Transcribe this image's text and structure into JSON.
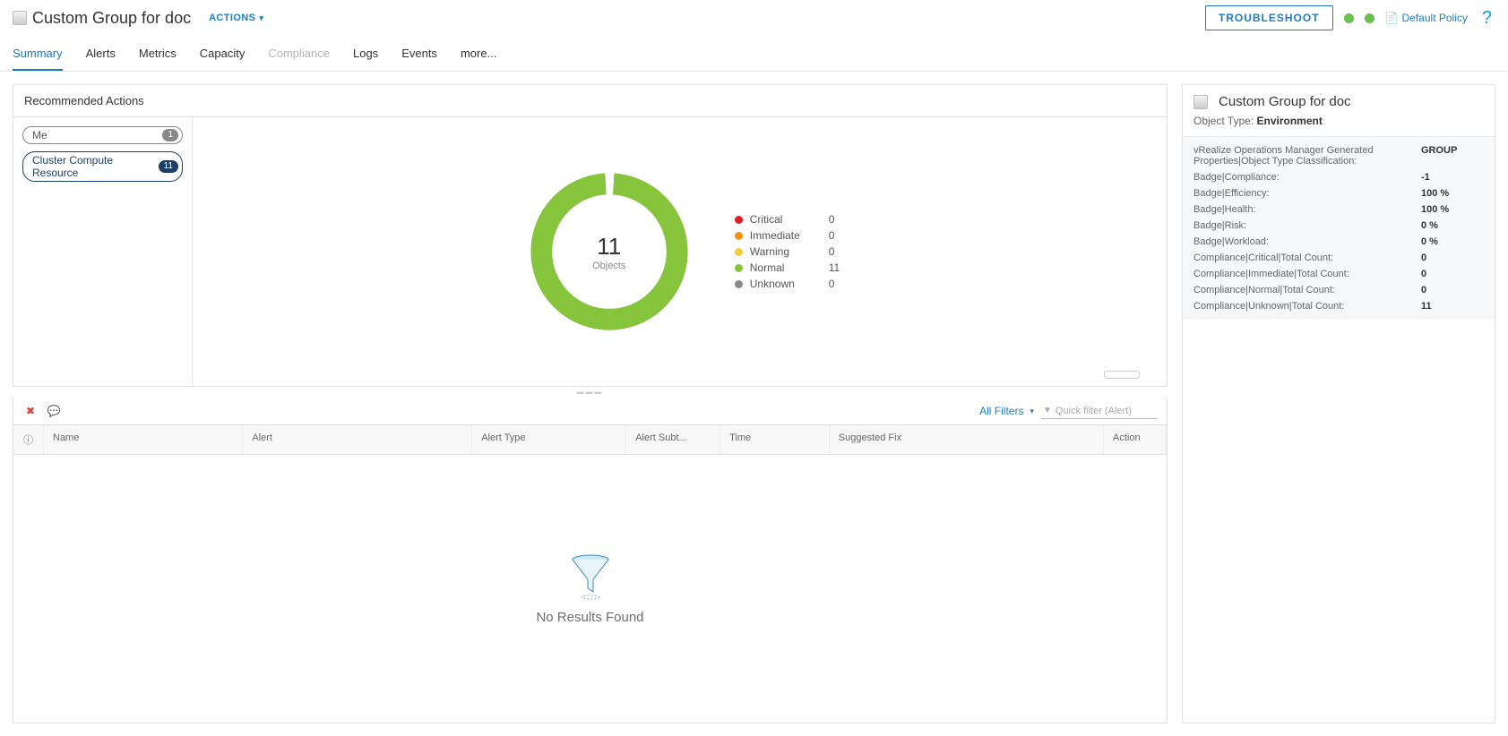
{
  "header": {
    "title": "Custom Group for doc",
    "actions_label": "ACTIONS",
    "troubleshoot_label": "TROUBLESHOOT",
    "policy_label": "Default Policy"
  },
  "tabs": [
    {
      "label": "Summary",
      "active": true,
      "disabled": false
    },
    {
      "label": "Alerts",
      "active": false,
      "disabled": false
    },
    {
      "label": "Metrics",
      "active": false,
      "disabled": false
    },
    {
      "label": "Capacity",
      "active": false,
      "disabled": false
    },
    {
      "label": "Compliance",
      "active": false,
      "disabled": true
    },
    {
      "label": "Logs",
      "active": false,
      "disabled": false
    },
    {
      "label": "Events",
      "active": false,
      "disabled": false
    },
    {
      "label": "more...",
      "active": false,
      "disabled": false
    }
  ],
  "recommended": {
    "title": "Recommended Actions",
    "filters": [
      {
        "label": "Me",
        "count": "1",
        "active": false
      },
      {
        "label": "Cluster Compute Resource",
        "count": "11",
        "active": true
      }
    ]
  },
  "chart_data": {
    "type": "pie",
    "total_value": "11",
    "total_label": "Objects",
    "series": [
      {
        "name": "Critical",
        "value": 0,
        "color": "#e02020"
      },
      {
        "name": "Immediate",
        "value": 0,
        "color": "#f2940a"
      },
      {
        "name": "Warning",
        "value": 0,
        "color": "#f0cd3d"
      },
      {
        "name": "Normal",
        "value": 11,
        "color": "#85c43b"
      },
      {
        "name": "Unknown",
        "value": 0,
        "color": "#8a8a8a"
      }
    ]
  },
  "alerts": {
    "all_filters_label": "All Filters",
    "quick_filter_placeholder": "Quick filter (Alert)",
    "columns": {
      "name": "Name",
      "alert": "Alert",
      "type": "Alert Type",
      "sub": "Alert Subt...",
      "time": "Time",
      "fix": "Suggested Fix",
      "action": "Action"
    },
    "no_results": "No Results Found"
  },
  "side": {
    "title": "Custom Group for doc",
    "obj_type_label": "Object Type:",
    "obj_type_value": "Environment",
    "props": [
      {
        "k": "vRealize Operations Manager Generated Properties|Object Type Classification:",
        "v": "GROUP"
      },
      {
        "k": "Badge|Compliance:",
        "v": "-1"
      },
      {
        "k": "Badge|Efficiency:",
        "v": "100 %"
      },
      {
        "k": "Badge|Health:",
        "v": "100 %"
      },
      {
        "k": "Badge|Risk:",
        "v": "0 %"
      },
      {
        "k": "Badge|Workload:",
        "v": "0 %"
      },
      {
        "k": "Compliance|Critical|Total Count:",
        "v": "0"
      },
      {
        "k": "Compliance|Immediate|Total Count:",
        "v": "0"
      },
      {
        "k": "Compliance|Normal|Total Count:",
        "v": "0"
      },
      {
        "k": "Compliance|Unknown|Total Count:",
        "v": "11"
      }
    ]
  }
}
